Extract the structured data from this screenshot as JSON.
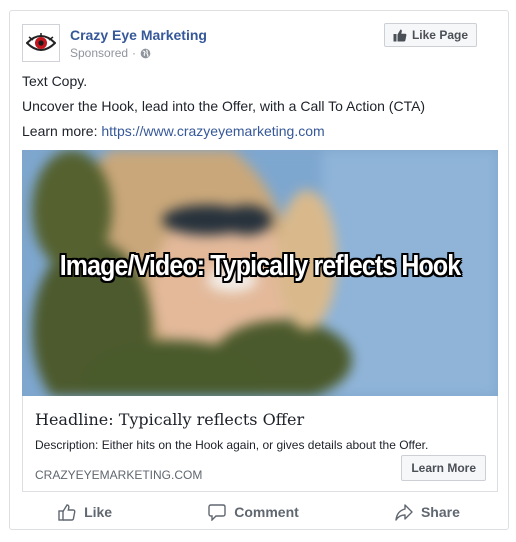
{
  "post": {
    "page_name": "Crazy Eye Marketing",
    "sponsored": "Sponsored",
    "dot": "·",
    "like_page_label": "Like Page",
    "text_copy": "Text Copy.",
    "text_body": "Uncover the Hook, lead into the Offer, with a Call To Action (CTA)",
    "learn_more_prefix": "Learn more: ",
    "learn_more_url": "https://www.crazyeyemarketing.com"
  },
  "media": {
    "overlay_text": "Image/Video: Typically reflects Hook"
  },
  "link_preview": {
    "headline": "Headline: Typically reflects Offer",
    "description": "Description: Either hits on the Hook again, or gives details about the Offer.",
    "domain": "CRAZYEYEMARKETING.COM",
    "cta_label": "Learn More"
  },
  "actions": {
    "like": "Like",
    "comment": "Comment",
    "share": "Share"
  },
  "colors": {
    "link": "#365899",
    "accent_red": "#c0161c"
  },
  "icons": {
    "avatar": "eye-logo-icon",
    "globe": "globe-icon",
    "like_page": "thumbs-up-icon",
    "like": "thumbs-up-outline-icon",
    "comment": "speech-bubble-icon",
    "share": "share-arrow-icon"
  }
}
